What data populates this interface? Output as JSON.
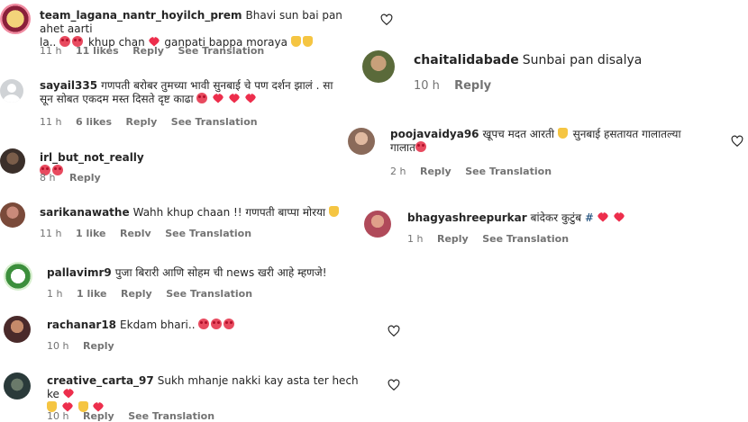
{
  "left_comments": [
    {
      "user": "team_lagana_nantr_hoyilch_prem",
      "text_line1": "Bhavi sun bai pan ahet aarti",
      "text_line2": "la..",
      "text_line2_tail": "khup chan",
      "text_line2_end": "ganpati bappa moraya",
      "time": "11 h",
      "likes": "11 likes",
      "reply": "Reply",
      "translate": "See Translation"
    },
    {
      "user": "sayail335",
      "text_line1": "गणपती बरोबर तुमच्या भावी सुनबाई चे पण दर्शन झालं . सा",
      "text_line2": "सून सोबत एकदम मस्त दिसते दृष्ट काढा",
      "time": "11 h",
      "likes": "6 likes",
      "reply": "Reply",
      "translate": "See Translation"
    },
    {
      "user": "irl_but_not_really",
      "time": "8 h",
      "reply": "Reply"
    },
    {
      "user": "sarikanawathe",
      "text_line1": "Wahh khup chaan !! गणपती बाप्पा मोरया",
      "time": "11 h",
      "likes": "1 like",
      "reply": "Reply",
      "translate": "See Translation"
    },
    {
      "user": "pallavimr9",
      "text_line1": "पुजा बिरारी आणि सोहम ची news खरी आहे म्हणजे!",
      "time": "1 h",
      "likes": "1 like",
      "reply": "Reply",
      "translate": "See Translation"
    },
    {
      "user": "rachanar18",
      "text_line1": "Ekdam bhari..",
      "time": "10 h",
      "reply": "Reply"
    },
    {
      "user": "creative_carta_97",
      "text_line1": "Sukh mhanje nakki kay asta ter hech ke",
      "time": "10 h",
      "reply": "Reply",
      "translate": "See Translation"
    }
  ],
  "right_comments": [
    {
      "user": "chaitalidabade",
      "text_line1": "Sunbai pan disalya",
      "time": "10 h",
      "reply": "Reply"
    },
    {
      "user": "poojavaidya96",
      "text_line1": "खूपच मदत आरती",
      "text_line1_tail": "सुनबाई हसतायत गालातल्या",
      "text_line2": "गालात",
      "time": "2 h",
      "reply": "Reply",
      "translate": "See Translation"
    },
    {
      "user": "bhagyashreepurkar",
      "text_line1": "बांदेकर कुटुंब",
      "time": "1 h",
      "reply": "Reply",
      "translate": "See Translation"
    }
  ],
  "colors": {
    "heart_red": "#ed2e4c",
    "meta_gray": "#737373"
  },
  "icons": [
    "heart-outline-icon",
    "heart-emoji",
    "heart-eyes-emoji",
    "folded-hands-emoji",
    "default-avatar-icon"
  ]
}
